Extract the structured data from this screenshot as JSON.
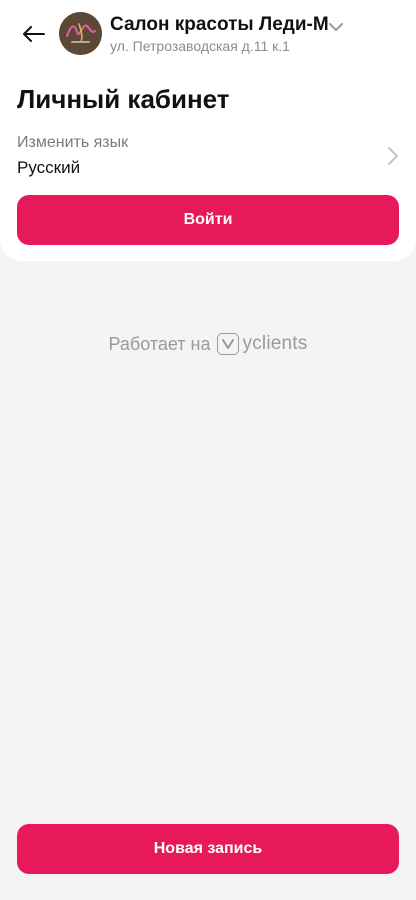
{
  "header": {
    "salon_name": "Салон красоты Леди-М",
    "address": "ул. Петрозаводская д.11 к.1",
    "avatar_text": "Леди-М"
  },
  "page": {
    "title": "Личный кабинет"
  },
  "language": {
    "label": "Изменить язык",
    "value": "Русский"
  },
  "buttons": {
    "login": "Войти",
    "new_booking": "Новая запись"
  },
  "footer": {
    "powered_by": "Работает на",
    "brand": "yclients"
  },
  "colors": {
    "accent": "#e8195a",
    "background": "#f4f4f4"
  }
}
